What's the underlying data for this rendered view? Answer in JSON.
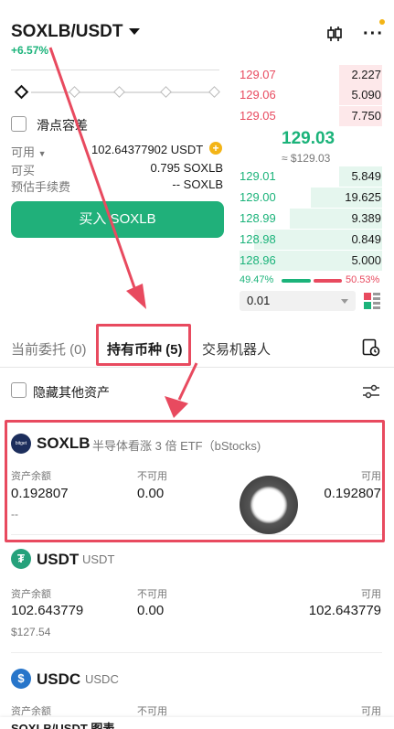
{
  "header": {
    "pair": "SOXLB/USDT",
    "change": "+6.57%"
  },
  "form": {
    "slippage_label": "滑点容差",
    "available_label": "可用",
    "available_value": "102.64377902 USDT",
    "can_buy_label": "可买",
    "can_buy_value": "0.795 SOXLB",
    "fee_label": "预估手续费",
    "fee_value": "-- SOXLB",
    "buy_button": "买入 SOXLB"
  },
  "orderbook": {
    "asks": [
      {
        "price": "129.07",
        "qty": "2.227",
        "depth": 0.3
      },
      {
        "price": "129.06",
        "qty": "5.090",
        "depth": 0.3
      },
      {
        "price": "129.05",
        "qty": "7.750",
        "depth": 0.3
      }
    ],
    "mid_price": "129.03",
    "mid_ref": "≈ $129.03",
    "bids": [
      {
        "price": "129.01",
        "qty": "5.849",
        "depth": 0.3
      },
      {
        "price": "129.00",
        "qty": "19.625",
        "depth": 0.5
      },
      {
        "price": "128.99",
        "qty": "9.389",
        "depth": 0.65
      },
      {
        "price": "128.98",
        "qty": "0.849",
        "depth": 0.9
      },
      {
        "price": "128.96",
        "qty": "5.000",
        "depth": 1.0
      }
    ],
    "buy_ratio": "49.47%",
    "sell_ratio": "50.53%",
    "precision": "0.01"
  },
  "tabs": {
    "orders": "当前委托 (0)",
    "holdings": "持有币种 (5)",
    "bots": "交易机器人"
  },
  "filter": {
    "hide_label": "隐藏其他资产"
  },
  "columns": {
    "balance": "资产余额",
    "unavailable": "不可用",
    "available": "可用"
  },
  "assets": [
    {
      "symbol": "SOXLB",
      "name": "半导体看涨 3 倍 ETF（bStocks)",
      "balance": "0.192807",
      "unavailable": "0.00",
      "available": "0.192807",
      "usd": "--",
      "logo_text": "bitget"
    },
    {
      "symbol": "USDT",
      "name": "USDT",
      "balance": "102.643779",
      "unavailable": "0.00",
      "available": "102.643779",
      "usd": "$127.54"
    },
    {
      "symbol": "USDC",
      "name": "USDC",
      "balance": "",
      "unavailable": "",
      "available": "",
      "usd": ""
    }
  ],
  "footer": {
    "chart_link": "SOXLB/USDT 图表"
  },
  "colors": {
    "green": "#1bb37a",
    "red": "#e84a5f",
    "accent": "#f3b416"
  }
}
